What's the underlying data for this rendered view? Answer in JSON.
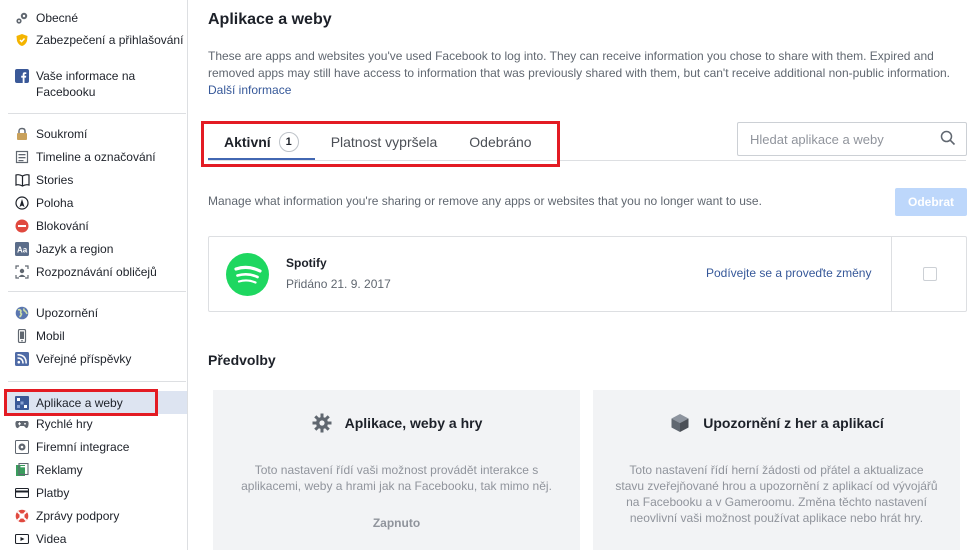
{
  "sidebar": {
    "groups": [
      {
        "items": [
          {
            "label": "Obecné",
            "icon": "gears-icon"
          },
          {
            "label": "Zabezpečení a přihlašování",
            "icon": "shield-icon"
          },
          {
            "label": "Vaše informace na Facebooku",
            "icon": "facebook-icon"
          }
        ]
      },
      {
        "items": [
          {
            "label": "Soukromí",
            "icon": "lock-icon"
          },
          {
            "label": "Timeline a označování",
            "icon": "timeline-icon"
          },
          {
            "label": "Stories",
            "icon": "book-icon"
          },
          {
            "label": "Poloha",
            "icon": "location-icon"
          },
          {
            "label": "Blokování",
            "icon": "block-icon"
          },
          {
            "label": "Jazyk a region",
            "icon": "language-icon"
          },
          {
            "label": "Rozpoznávání obličejů",
            "icon": "face-icon"
          }
        ]
      },
      {
        "items": [
          {
            "label": "Upozornění",
            "icon": "globe-icon"
          },
          {
            "label": "Mobil",
            "icon": "phone-icon"
          },
          {
            "label": "Veřejné příspěvky",
            "icon": "rss-icon"
          }
        ]
      },
      {
        "items": [
          {
            "label": "Aplikace a weby",
            "icon": "apps-icon",
            "active": true
          },
          {
            "label": "Rychlé hry",
            "icon": "gamepad-icon"
          },
          {
            "label": "Firemní integrace",
            "icon": "gear-icon"
          },
          {
            "label": "Reklamy",
            "icon": "ads-icon"
          },
          {
            "label": "Platby",
            "icon": "card-icon"
          },
          {
            "label": "Zprávy podpory",
            "icon": "lifebuoy-icon"
          },
          {
            "label": "Videa",
            "icon": "video-icon"
          }
        ]
      }
    ]
  },
  "main": {
    "title": "Aplikace a weby",
    "intro": "These are apps and websites you've used Facebook to log into. They can receive information you chose to share with them. Expired and removed apps may still have access to information that was previously shared with them, but can't receive additional non-public information.",
    "intro_link": "Další informace",
    "tabs": [
      {
        "label": "Aktivní",
        "badge": "1",
        "active": true
      },
      {
        "label": "Platnost vypršela"
      },
      {
        "label": "Odebráno"
      }
    ],
    "search_placeholder": "Hledat aplikace a weby",
    "manage_text": "Manage what information you're sharing or remove any apps or websites that you no longer want to use.",
    "remove_button": "Odebrat",
    "apps": [
      {
        "name": "Spotify",
        "added": "Přidáno 21. 9. 2017",
        "link": "Podívejte se a proveďte změny",
        "icon": "spotify-icon"
      }
    ],
    "preferences_title": "Předvolby",
    "preferences": [
      {
        "title": "Aplikace, weby a hry",
        "icon": "gear-icon",
        "description": "Toto nastavení řídí vaši možnost provádět interakce s aplikacemi, weby a hrami jak na Facebooku, tak mimo něj.",
        "status": "Zapnuto"
      },
      {
        "title": "Upozornění z her a aplikací",
        "icon": "cube-icon",
        "description": "Toto nastavení řídí herní žádosti od přátel a aktualizace stavu zveřejňované hrou a upozornění z aplikací od vývojářů na Facebooku a v Gameroomu. Změna těchto nastavení neovlivní vaši možnost používat aplikace nebo hrát hry.",
        "status": ""
      }
    ]
  },
  "colors": {
    "accent": "#4267b2",
    "link": "#365899",
    "highlight": "#e31b23",
    "spotify": "#1ed760",
    "active_row": "#dde4f1"
  }
}
